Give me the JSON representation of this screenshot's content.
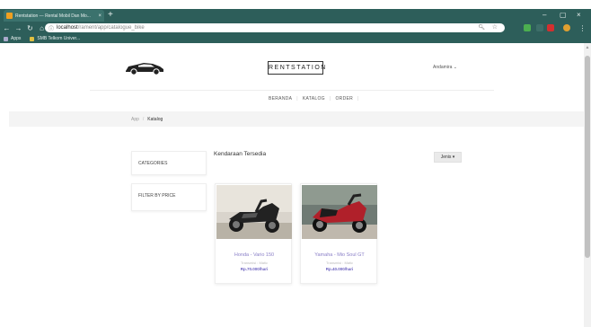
{
  "browser": {
    "tab_title": "Rentstation — Rental Mobil Dan Mo...",
    "tab_close": "×",
    "new_tab": "+",
    "window_controls": [
      "–",
      "▢",
      "×"
    ],
    "url_host": "localhost",
    "url_path": "/rament/app/catalogue_bike",
    "bookmarks": [
      "Apps",
      "SMB Telkom Univer..."
    ],
    "accent_color": "#2d5e5a"
  },
  "header": {
    "brand": "RENTSTATION",
    "user_menu": "Andamira ⌄"
  },
  "nav": {
    "items": [
      "BERANDA",
      "KATALOG",
      "ORDER"
    ]
  },
  "breadcrumb": {
    "root": "App",
    "separator": "/",
    "current": "Katalog"
  },
  "sidebar": {
    "categories_title": "CATEGORIES",
    "filter_title": "FILTER BY PRICE"
  },
  "main": {
    "section_title": "Kendaraan Tersedia",
    "jenis_button": "Jenis ▾",
    "cards": [
      {
        "name": "Honda - Vario 150",
        "transmission": "Transmisi : Matic",
        "price": "Rp.70.000/hari"
      },
      {
        "name": "Yamaha - Mio Soul GT",
        "transmission": "Transmisi : Matic",
        "price": "Rp.40.000/hari"
      }
    ]
  }
}
